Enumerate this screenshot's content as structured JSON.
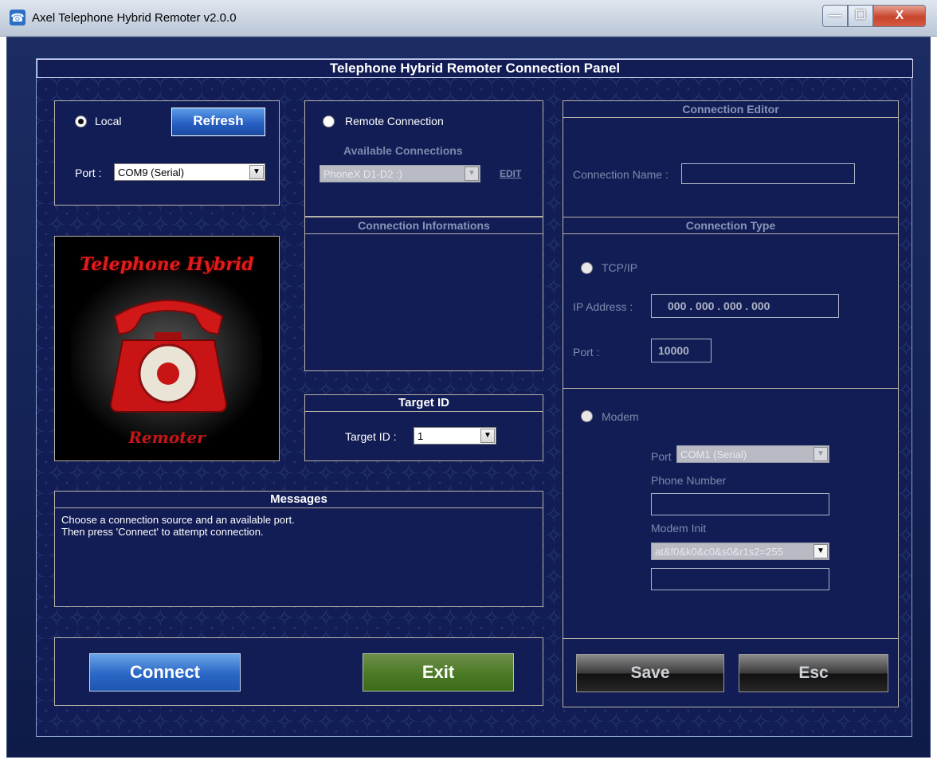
{
  "window": {
    "title": "Axel Telephone Hybrid Remoter v2.0.0",
    "min": "—",
    "max": "☐",
    "close": "X"
  },
  "header": {
    "title": "Telephone Hybrid Remoter Connection Panel"
  },
  "local": {
    "radio_label": "Local",
    "selected": true,
    "refresh_label": "Refresh",
    "port_label": "Port :",
    "port_value": "COM9  (Serial)"
  },
  "remote": {
    "radio_label": "Remote Connection",
    "available_title": "Available Connections",
    "connection_value": "PhoneX D1-D2 :)",
    "edit_label": "EDIT"
  },
  "connection_info": {
    "title": "Connection Informations"
  },
  "target": {
    "title": "Target ID",
    "label": "Target ID :",
    "value": "1"
  },
  "logo": {
    "line1": "Telephone Hybrid",
    "line2": "Remoter"
  },
  "messages": {
    "title": "Messages",
    "line1": "Choose a connection source and an available port.",
    "line2": "Then press 'Connect' to attempt connection."
  },
  "actions": {
    "connect": "Connect",
    "exit": "Exit",
    "save": "Save",
    "esc": "Esc"
  },
  "editor": {
    "title": "Connection Editor",
    "name_label": "Connection Name :",
    "type_title": "Connection Type",
    "tcp_label": "TCP/IP",
    "ip_label": "IP Address :",
    "ip_value": "000 . 000 . 000 . 000",
    "port_label": "Port :",
    "port_value": "10000",
    "modem_label": "Modem",
    "modem_port_label": "Port",
    "modem_port_value": "COM1  (Serial)",
    "phone_label": "Phone Number",
    "init_label": "Modem Init",
    "init_value": "at&f0&k0&c0&s0&r1s2=255"
  }
}
